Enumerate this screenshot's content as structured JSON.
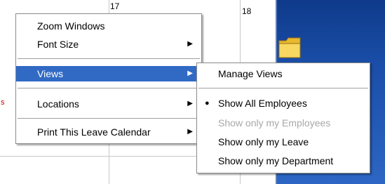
{
  "calendar": {
    "day_17": "17",
    "day_18": "18",
    "red_text": "s"
  },
  "context_menu": {
    "items": [
      {
        "label": "Zoom Windows"
      },
      {
        "label": "Font Size",
        "arrow": "▶"
      },
      {
        "label": "Views",
        "arrow": "▶",
        "highlighted": true
      },
      {
        "label": "Locations",
        "arrow": "▶"
      },
      {
        "label": "Print This Leave Calendar",
        "arrow": "▶"
      }
    ]
  },
  "views_submenu": {
    "items": [
      {
        "label": "Manage Views"
      },
      {
        "label": "Show All Employees",
        "selected": true,
        "bullet": "●"
      },
      {
        "label": "Show only my Employees",
        "disabled": true
      },
      {
        "label": "Show only my Leave"
      },
      {
        "label": "Show only my Department"
      }
    ]
  },
  "colors": {
    "highlight": "#316ac5",
    "disabled_text": "#a8a8a8",
    "desktop": "#1a4ea8"
  },
  "icons": {
    "submenu_arrow": "arrow-right-icon",
    "radio_bullet": "bullet-icon",
    "desktop_folder": "folder-icon"
  }
}
